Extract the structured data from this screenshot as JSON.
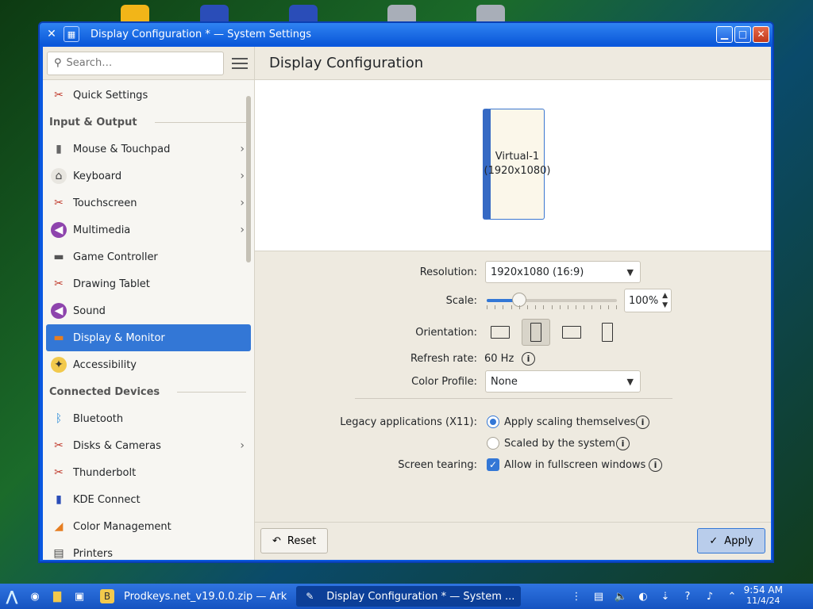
{
  "window": {
    "title": "Display Configuration * — System Settings"
  },
  "sidebar": {
    "search_placeholder": "Search…",
    "items": [
      {
        "label": "Quick Settings",
        "icon": "tools-icon",
        "chevron": false
      },
      {
        "header": "Input & Output"
      },
      {
        "label": "Mouse & Touchpad",
        "icon": "mouse-icon",
        "chevron": true
      },
      {
        "label": "Keyboard",
        "icon": "keyboard-icon",
        "chevron": true
      },
      {
        "label": "Touchscreen",
        "icon": "tools-icon",
        "chevron": true
      },
      {
        "label": "Multimedia",
        "icon": "speaker-icon",
        "chevron": true
      },
      {
        "label": "Game Controller",
        "icon": "gamepad-icon",
        "chevron": false
      },
      {
        "label": "Drawing Tablet",
        "icon": "tools-icon",
        "chevron": false
      },
      {
        "label": "Sound",
        "icon": "speaker-icon",
        "chevron": false
      },
      {
        "label": "Display & Monitor",
        "icon": "monitor-icon",
        "chevron": false,
        "active": true
      },
      {
        "label": "Accessibility",
        "icon": "accessibility-icon",
        "chevron": false
      },
      {
        "header": "Connected Devices"
      },
      {
        "label": "Bluetooth",
        "icon": "bluetooth-icon",
        "chevron": false
      },
      {
        "label": "Disks & Cameras",
        "icon": "tools-icon",
        "chevron": true
      },
      {
        "label": "Thunderbolt",
        "icon": "tools-icon",
        "chevron": false
      },
      {
        "label": "KDE Connect",
        "icon": "phone-icon",
        "chevron": false
      },
      {
        "label": "Color Management",
        "icon": "color-icon",
        "chevron": false
      },
      {
        "label": "Printers",
        "icon": "printer-icon",
        "chevron": false
      }
    ]
  },
  "main": {
    "heading": "Display Configuration",
    "monitor_label": "Virtual-1 (1920x1080)",
    "resolution": {
      "label": "Resolution:",
      "value": "1920x1080 (16:9)"
    },
    "scale": {
      "label": "Scale:",
      "value": "100%",
      "fraction": 0.22
    },
    "orientation": {
      "label": "Orientation:",
      "selected_index": 1
    },
    "refresh": {
      "label": "Refresh rate:",
      "value": "60 Hz"
    },
    "color_profile": {
      "label": "Color Profile:",
      "value": "None"
    },
    "legacy": {
      "label": "Legacy applications (X11):",
      "option1": "Apply scaling themselves",
      "option2": "Scaled by the system"
    },
    "tearing": {
      "label": "Screen tearing:",
      "option": "Allow in fullscreen windows"
    },
    "reset_label": "Reset",
    "apply_label": "Apply"
  },
  "taskbar": {
    "task1": "Prodkeys.net_v19.0.0.zip — Ark",
    "task2": "Display Configuration * — System ...",
    "time": "9:54 AM",
    "date": "11/4/24"
  },
  "colors": {
    "accent": "#3377d6",
    "titlebar": "#0a57d8"
  }
}
